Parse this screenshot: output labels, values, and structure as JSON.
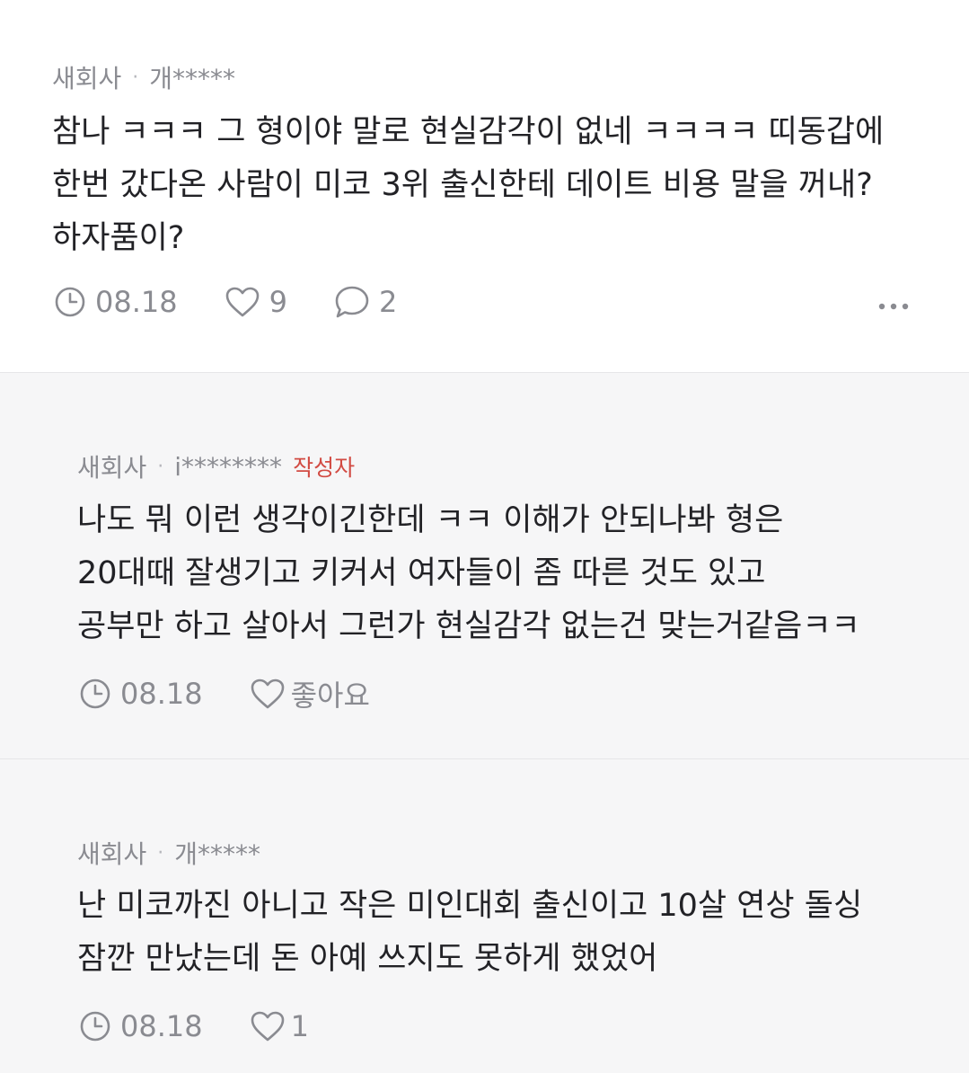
{
  "comments": [
    {
      "company": "새회사",
      "author": "개*****",
      "lines": [
        "참나 ㅋㅋㅋ 그 형이야 말로 현실감각이 없네 ㅋㅋㅋㅋ 띠동갑에",
        "한번 갔다온 사람이 미코 3위 출신한테 데이트 비용 말을 꺼내?",
        "하자품이?"
      ],
      "date": "08.18",
      "likes": "9",
      "replies": "2"
    },
    {
      "company": "새회사",
      "author": "i********",
      "author_badge": "작성자",
      "lines": [
        "나도 뭐 이런 생각이긴한데 ㅋㅋ 이해가 안되나봐 형은",
        "20대때 잘생기고 키커서 여자들이 좀 따른 것도 있고",
        "공부만 하고 살아서 그런가 현실감각 없는건 맞는거같음ㅋㅋ"
      ],
      "date": "08.18",
      "likes": "좋아요"
    },
    {
      "company": "새회사",
      "author": "개*****",
      "lines": [
        "난 미코까진 아니고 작은 미인대회 출신이고 10살 연상 돌싱",
        "잠깐 만났는데 돈 아예 쓰지도 못하게 했었어"
      ],
      "date": "08.18",
      "likes": "1"
    }
  ],
  "meta_separator": "·",
  "colors": {
    "meta_text": "#8a8b91",
    "body_text": "#222226",
    "author_badge": "#d24b43",
    "reply_background": "#f6f6f7"
  },
  "icons": [
    "clock-icon",
    "heart-icon",
    "comment-bubble-icon",
    "more-horizontal-icon"
  ]
}
